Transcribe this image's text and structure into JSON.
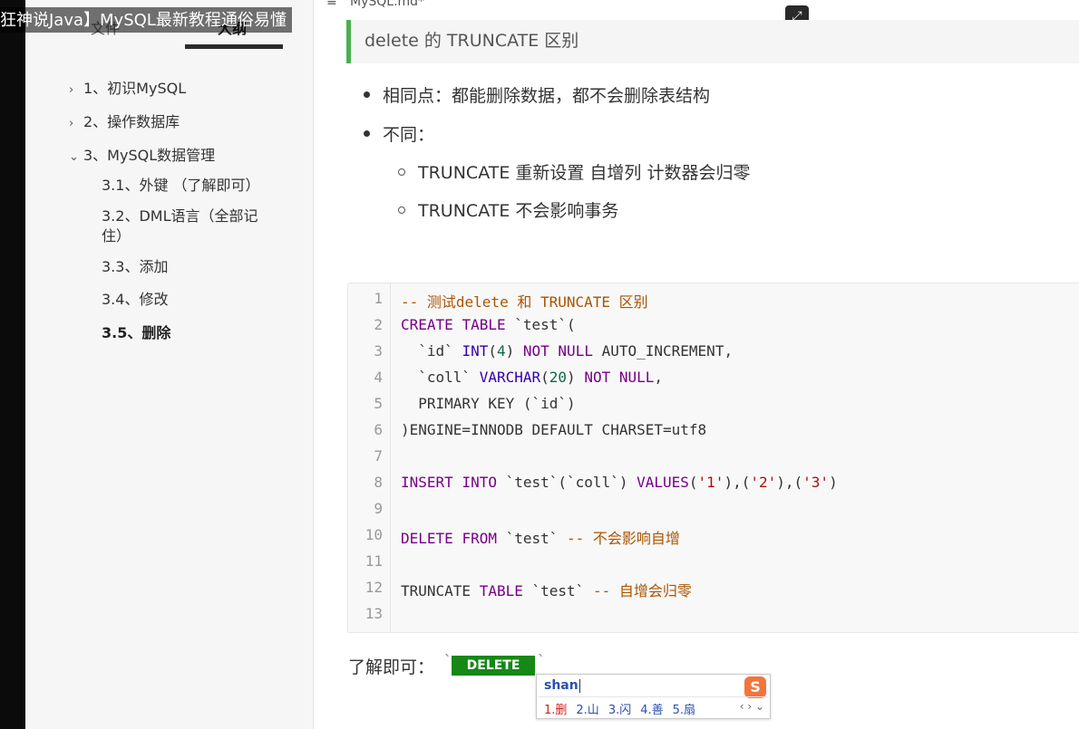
{
  "video_title": "狂神说Java】MySQL最新教程通俗易懂",
  "document": {
    "filename": "MySQL.md*"
  },
  "sidebar": {
    "tabs": [
      {
        "label": "文件"
      },
      {
        "label": "大纲"
      }
    ],
    "toc": [
      {
        "label": "1、初识MySQL",
        "chevron": "›"
      },
      {
        "label": "2、操作数据库",
        "chevron": "›"
      },
      {
        "label": "3、MySQL数据管理",
        "chevron": "⌄"
      }
    ],
    "sub": [
      {
        "label": "3.1、外键 （了解即可）"
      },
      {
        "label": "3.2、DML语言（全部记"
      },
      {
        "label": "住）"
      },
      {
        "label": "3.3、添加"
      },
      {
        "label": "3.4、修改"
      },
      {
        "label": "3.5、删除"
      }
    ]
  },
  "content": {
    "quote": "delete 的  TRUNCATE  区别",
    "bullets": [
      {
        "text": "相同点：都能删除数据，都不会删除表结构"
      },
      {
        "text": "不同："
      }
    ],
    "subbullets": [
      {
        "text": "TRUNCATE   重新设置 自增列 计数器会归零"
      },
      {
        "text": "TRUNCATE   不会影响事务"
      }
    ],
    "code": {
      "line_numbers": [
        "1",
        "2",
        "3",
        "4",
        "5",
        "6",
        "7",
        "8",
        "9",
        "10",
        "11",
        "12",
        "13"
      ],
      "lines": {
        "l1": {
          "a": "-- 测试delete 和 TRUNCATE 区别"
        },
        "l2": {
          "a": "CREATE",
          "b": " ",
          "c": "TABLE",
          "d": " `test`("
        },
        "l3": {
          "a": "  `id` ",
          "b": "INT",
          "c": "(",
          "d": "4",
          "e": ") ",
          "f": "NOT NULL",
          "g": " AUTO_INCREMENT,"
        },
        "l4": {
          "a": "  `coll` ",
          "b": "VARCHAR",
          "c": "(",
          "d": "20",
          "e": ") ",
          "f": "NOT NULL",
          "g": ","
        },
        "l5": {
          "a": "  PRIMARY KEY (`id`)"
        },
        "l6": {
          "a": ")ENGINE=INNODB DEFAULT CHARSET=utf8"
        },
        "l8": {
          "a": "INSERT",
          "b": " ",
          "c": "INTO",
          "d": " `test`(`coll`) ",
          "e": "VALUES",
          "f": "(",
          "g": "'1'",
          "h": "),(",
          "i": "'2'",
          "j": "),(",
          "k": "'3'",
          "l": ")"
        },
        "l10": {
          "a": "DELETE",
          "b": " ",
          "c": "FROM",
          "d": " `test` ",
          "e": "-- 不会影响自增"
        },
        "l12": {
          "a": "TRUNCATE ",
          "b": "TABLE",
          "c": " `test` ",
          "d": "-- 自增会归零"
        }
      }
    },
    "footer": {
      "label": "了解即可：",
      "tick_left": "`",
      "tick_right": "`",
      "badge": "DELETE"
    }
  },
  "ime": {
    "input": "shan",
    "logo": "S",
    "candidates": [
      {
        "label": "1.删"
      },
      {
        "label": "2.山"
      },
      {
        "label": "3.闪"
      },
      {
        "label": "4.善"
      },
      {
        "label": "5.扇"
      }
    ],
    "nav": "‹ › ⌄"
  },
  "icons": {
    "expand": "⤢",
    "menu": "≡"
  },
  "colors": {
    "accent_green": "#4caf50",
    "badge_green": "#168816",
    "keyword": "#770088",
    "comment": "#aa5500"
  }
}
